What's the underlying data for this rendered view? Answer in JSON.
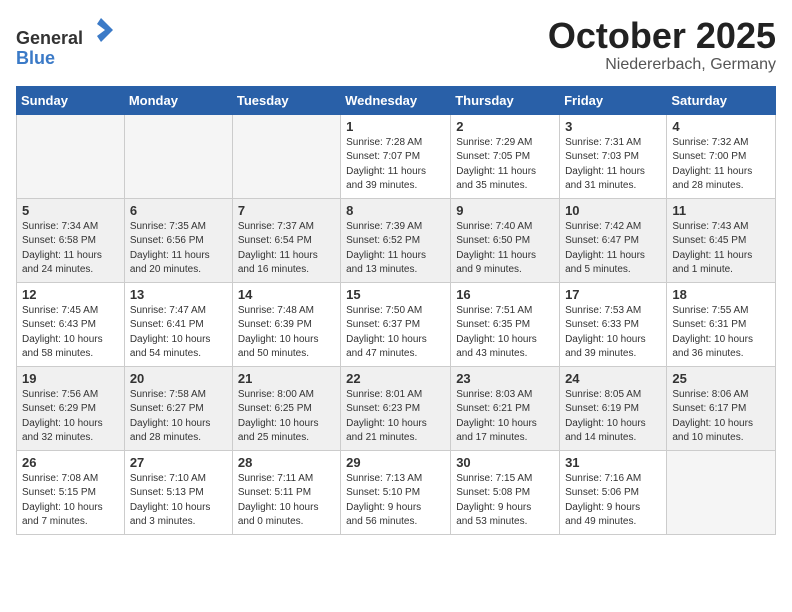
{
  "header": {
    "logo_line1": "General",
    "logo_line2": "Blue",
    "month": "October 2025",
    "location": "Niedererbach, Germany"
  },
  "weekdays": [
    "Sunday",
    "Monday",
    "Tuesday",
    "Wednesday",
    "Thursday",
    "Friday",
    "Saturday"
  ],
  "weeks": [
    [
      {
        "day": "",
        "info": ""
      },
      {
        "day": "",
        "info": ""
      },
      {
        "day": "",
        "info": ""
      },
      {
        "day": "1",
        "info": "Sunrise: 7:28 AM\nSunset: 7:07 PM\nDaylight: 11 hours\nand 39 minutes."
      },
      {
        "day": "2",
        "info": "Sunrise: 7:29 AM\nSunset: 7:05 PM\nDaylight: 11 hours\nand 35 minutes."
      },
      {
        "day": "3",
        "info": "Sunrise: 7:31 AM\nSunset: 7:03 PM\nDaylight: 11 hours\nand 31 minutes."
      },
      {
        "day": "4",
        "info": "Sunrise: 7:32 AM\nSunset: 7:00 PM\nDaylight: 11 hours\nand 28 minutes."
      }
    ],
    [
      {
        "day": "5",
        "info": "Sunrise: 7:34 AM\nSunset: 6:58 PM\nDaylight: 11 hours\nand 24 minutes."
      },
      {
        "day": "6",
        "info": "Sunrise: 7:35 AM\nSunset: 6:56 PM\nDaylight: 11 hours\nand 20 minutes."
      },
      {
        "day": "7",
        "info": "Sunrise: 7:37 AM\nSunset: 6:54 PM\nDaylight: 11 hours\nand 16 minutes."
      },
      {
        "day": "8",
        "info": "Sunrise: 7:39 AM\nSunset: 6:52 PM\nDaylight: 11 hours\nand 13 minutes."
      },
      {
        "day": "9",
        "info": "Sunrise: 7:40 AM\nSunset: 6:50 PM\nDaylight: 11 hours\nand 9 minutes."
      },
      {
        "day": "10",
        "info": "Sunrise: 7:42 AM\nSunset: 6:47 PM\nDaylight: 11 hours\nand 5 minutes."
      },
      {
        "day": "11",
        "info": "Sunrise: 7:43 AM\nSunset: 6:45 PM\nDaylight: 11 hours\nand 1 minute."
      }
    ],
    [
      {
        "day": "12",
        "info": "Sunrise: 7:45 AM\nSunset: 6:43 PM\nDaylight: 10 hours\nand 58 minutes."
      },
      {
        "day": "13",
        "info": "Sunrise: 7:47 AM\nSunset: 6:41 PM\nDaylight: 10 hours\nand 54 minutes."
      },
      {
        "day": "14",
        "info": "Sunrise: 7:48 AM\nSunset: 6:39 PM\nDaylight: 10 hours\nand 50 minutes."
      },
      {
        "day": "15",
        "info": "Sunrise: 7:50 AM\nSunset: 6:37 PM\nDaylight: 10 hours\nand 47 minutes."
      },
      {
        "day": "16",
        "info": "Sunrise: 7:51 AM\nSunset: 6:35 PM\nDaylight: 10 hours\nand 43 minutes."
      },
      {
        "day": "17",
        "info": "Sunrise: 7:53 AM\nSunset: 6:33 PM\nDaylight: 10 hours\nand 39 minutes."
      },
      {
        "day": "18",
        "info": "Sunrise: 7:55 AM\nSunset: 6:31 PM\nDaylight: 10 hours\nand 36 minutes."
      }
    ],
    [
      {
        "day": "19",
        "info": "Sunrise: 7:56 AM\nSunset: 6:29 PM\nDaylight: 10 hours\nand 32 minutes."
      },
      {
        "day": "20",
        "info": "Sunrise: 7:58 AM\nSunset: 6:27 PM\nDaylight: 10 hours\nand 28 minutes."
      },
      {
        "day": "21",
        "info": "Sunrise: 8:00 AM\nSunset: 6:25 PM\nDaylight: 10 hours\nand 25 minutes."
      },
      {
        "day": "22",
        "info": "Sunrise: 8:01 AM\nSunset: 6:23 PM\nDaylight: 10 hours\nand 21 minutes."
      },
      {
        "day": "23",
        "info": "Sunrise: 8:03 AM\nSunset: 6:21 PM\nDaylight: 10 hours\nand 17 minutes."
      },
      {
        "day": "24",
        "info": "Sunrise: 8:05 AM\nSunset: 6:19 PM\nDaylight: 10 hours\nand 14 minutes."
      },
      {
        "day": "25",
        "info": "Sunrise: 8:06 AM\nSunset: 6:17 PM\nDaylight: 10 hours\nand 10 minutes."
      }
    ],
    [
      {
        "day": "26",
        "info": "Sunrise: 7:08 AM\nSunset: 5:15 PM\nDaylight: 10 hours\nand 7 minutes."
      },
      {
        "day": "27",
        "info": "Sunrise: 7:10 AM\nSunset: 5:13 PM\nDaylight: 10 hours\nand 3 minutes."
      },
      {
        "day": "28",
        "info": "Sunrise: 7:11 AM\nSunset: 5:11 PM\nDaylight: 10 hours\nand 0 minutes."
      },
      {
        "day": "29",
        "info": "Sunrise: 7:13 AM\nSunset: 5:10 PM\nDaylight: 9 hours\nand 56 minutes."
      },
      {
        "day": "30",
        "info": "Sunrise: 7:15 AM\nSunset: 5:08 PM\nDaylight: 9 hours\nand 53 minutes."
      },
      {
        "day": "31",
        "info": "Sunrise: 7:16 AM\nSunset: 5:06 PM\nDaylight: 9 hours\nand 49 minutes."
      },
      {
        "day": "",
        "info": ""
      }
    ]
  ]
}
